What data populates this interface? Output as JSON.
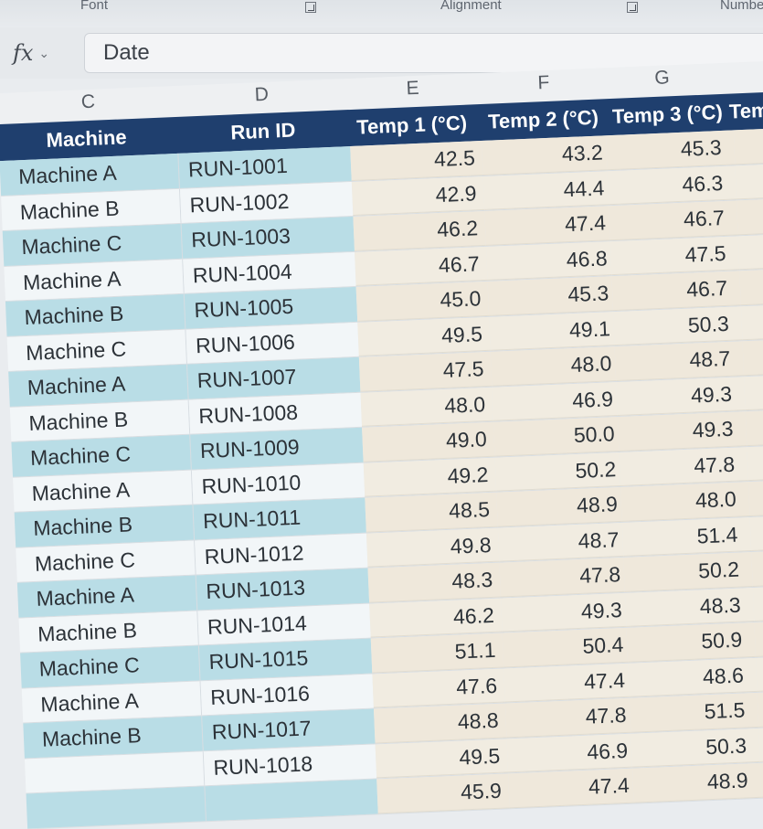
{
  "ribbon": {
    "group_left": "Font",
    "group_middle": "Alignment",
    "group_right": "Number"
  },
  "formula_bar": {
    "fx_label": "fx",
    "content": "Date"
  },
  "columns": [
    "C",
    "D",
    "E",
    "F",
    "G"
  ],
  "table": {
    "headers": [
      "Machine",
      "Run ID",
      "Temp 1 (°C)",
      "Temp 2 (°C)",
      "Temp 3 (°C)",
      "Tem"
    ],
    "rows": [
      [
        "Machine A",
        "RUN-1001",
        "42.5",
        "43.2",
        "45.3"
      ],
      [
        "Machine B",
        "RUN-1002",
        "42.9",
        "44.4",
        "46.3"
      ],
      [
        "Machine C",
        "RUN-1003",
        "46.2",
        "47.4",
        "46.7"
      ],
      [
        "Machine A",
        "RUN-1004",
        "46.7",
        "46.8",
        "47.5"
      ],
      [
        "Machine B",
        "RUN-1005",
        "45.0",
        "45.3",
        "46.7"
      ],
      [
        "Machine C",
        "RUN-1006",
        "49.5",
        "49.1",
        "50.3"
      ],
      [
        "Machine A",
        "RUN-1007",
        "47.5",
        "48.0",
        "48.7"
      ],
      [
        "Machine B",
        "RUN-1008",
        "48.0",
        "46.9",
        "49.3"
      ],
      [
        "Machine C",
        "RUN-1009",
        "49.0",
        "50.0",
        "49.3"
      ],
      [
        "Machine A",
        "RUN-1010",
        "49.2",
        "50.2",
        "47.8"
      ],
      [
        "Machine B",
        "RUN-1011",
        "48.5",
        "48.9",
        "48.0"
      ],
      [
        "Machine C",
        "RUN-1012",
        "49.8",
        "48.7",
        "51.4"
      ],
      [
        "Machine A",
        "RUN-1013",
        "48.3",
        "47.8",
        "50.2"
      ],
      [
        "Machine B",
        "RUN-1014",
        "46.2",
        "49.3",
        "48.3"
      ],
      [
        "Machine C",
        "RUN-1015",
        "51.1",
        "50.4",
        "50.9"
      ],
      [
        "Machine A",
        "RUN-1016",
        "47.6",
        "47.4",
        "48.6"
      ],
      [
        "Machine B",
        "RUN-1017",
        "48.8",
        "47.8",
        "51.5"
      ],
      [
        "",
        "RUN-1018",
        "49.5",
        "46.9",
        "50.3"
      ],
      [
        "",
        "",
        "45.9",
        "47.4",
        "48.9"
      ]
    ]
  },
  "colors": {
    "header_bg": "#1f3f6e",
    "band_blue": "#b9dde6",
    "band_light": "#f2f6f8"
  }
}
